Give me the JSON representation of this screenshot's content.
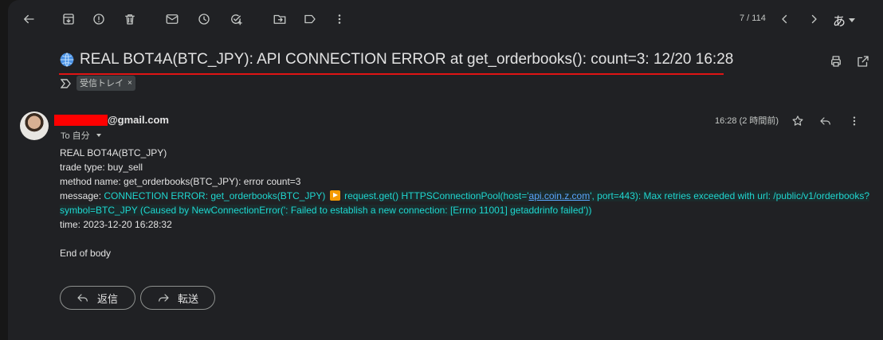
{
  "toolbar": {
    "counter": "7 / 114",
    "lang": "あ"
  },
  "subject": {
    "text": "REAL BOT4A(BTC_JPY): API CONNECTION ERROR at get_orderbooks(): count=3: 12/20 16:28",
    "label_chip": "受信トレイ",
    "chip_close": "×"
  },
  "message": {
    "sender_visible": "@gmail.com",
    "to": "To 自分",
    "time": "16:28 (2 時間前)",
    "lines": {
      "l1": "REAL BOT4A(BTC_JPY)",
      "l2": "trade type: buy_sell",
      "l3": "method name: get_orderbooks(BTC_JPY): error count=3",
      "l4_prefix": "message: ",
      "l4_a": "CONNECTION ERROR: get_orderbooks(BTC_JPY) ",
      "l4_b": " request.get() HTTPSConnectionPool(host='",
      "l4_link": "api.coin.z.com",
      "l4_c": "', port=443): Max retries exceeded with url: /public/v1/orderbooks?",
      "l5": "symbol=BTC_JPY (Caused by NewConnectionError(': Failed to establish a new connection: [Errno 11001] getaddrinfo failed'))",
      "l6": "time: 2023-12-20 16:28:32",
      "l7": "End of body"
    }
  },
  "actions": {
    "reply": "返信",
    "forward": "転送"
  },
  "colors": {
    "accent_cyan": "#1fd7d0",
    "underline_red": "#e01414",
    "redaction": "#ff0000"
  }
}
